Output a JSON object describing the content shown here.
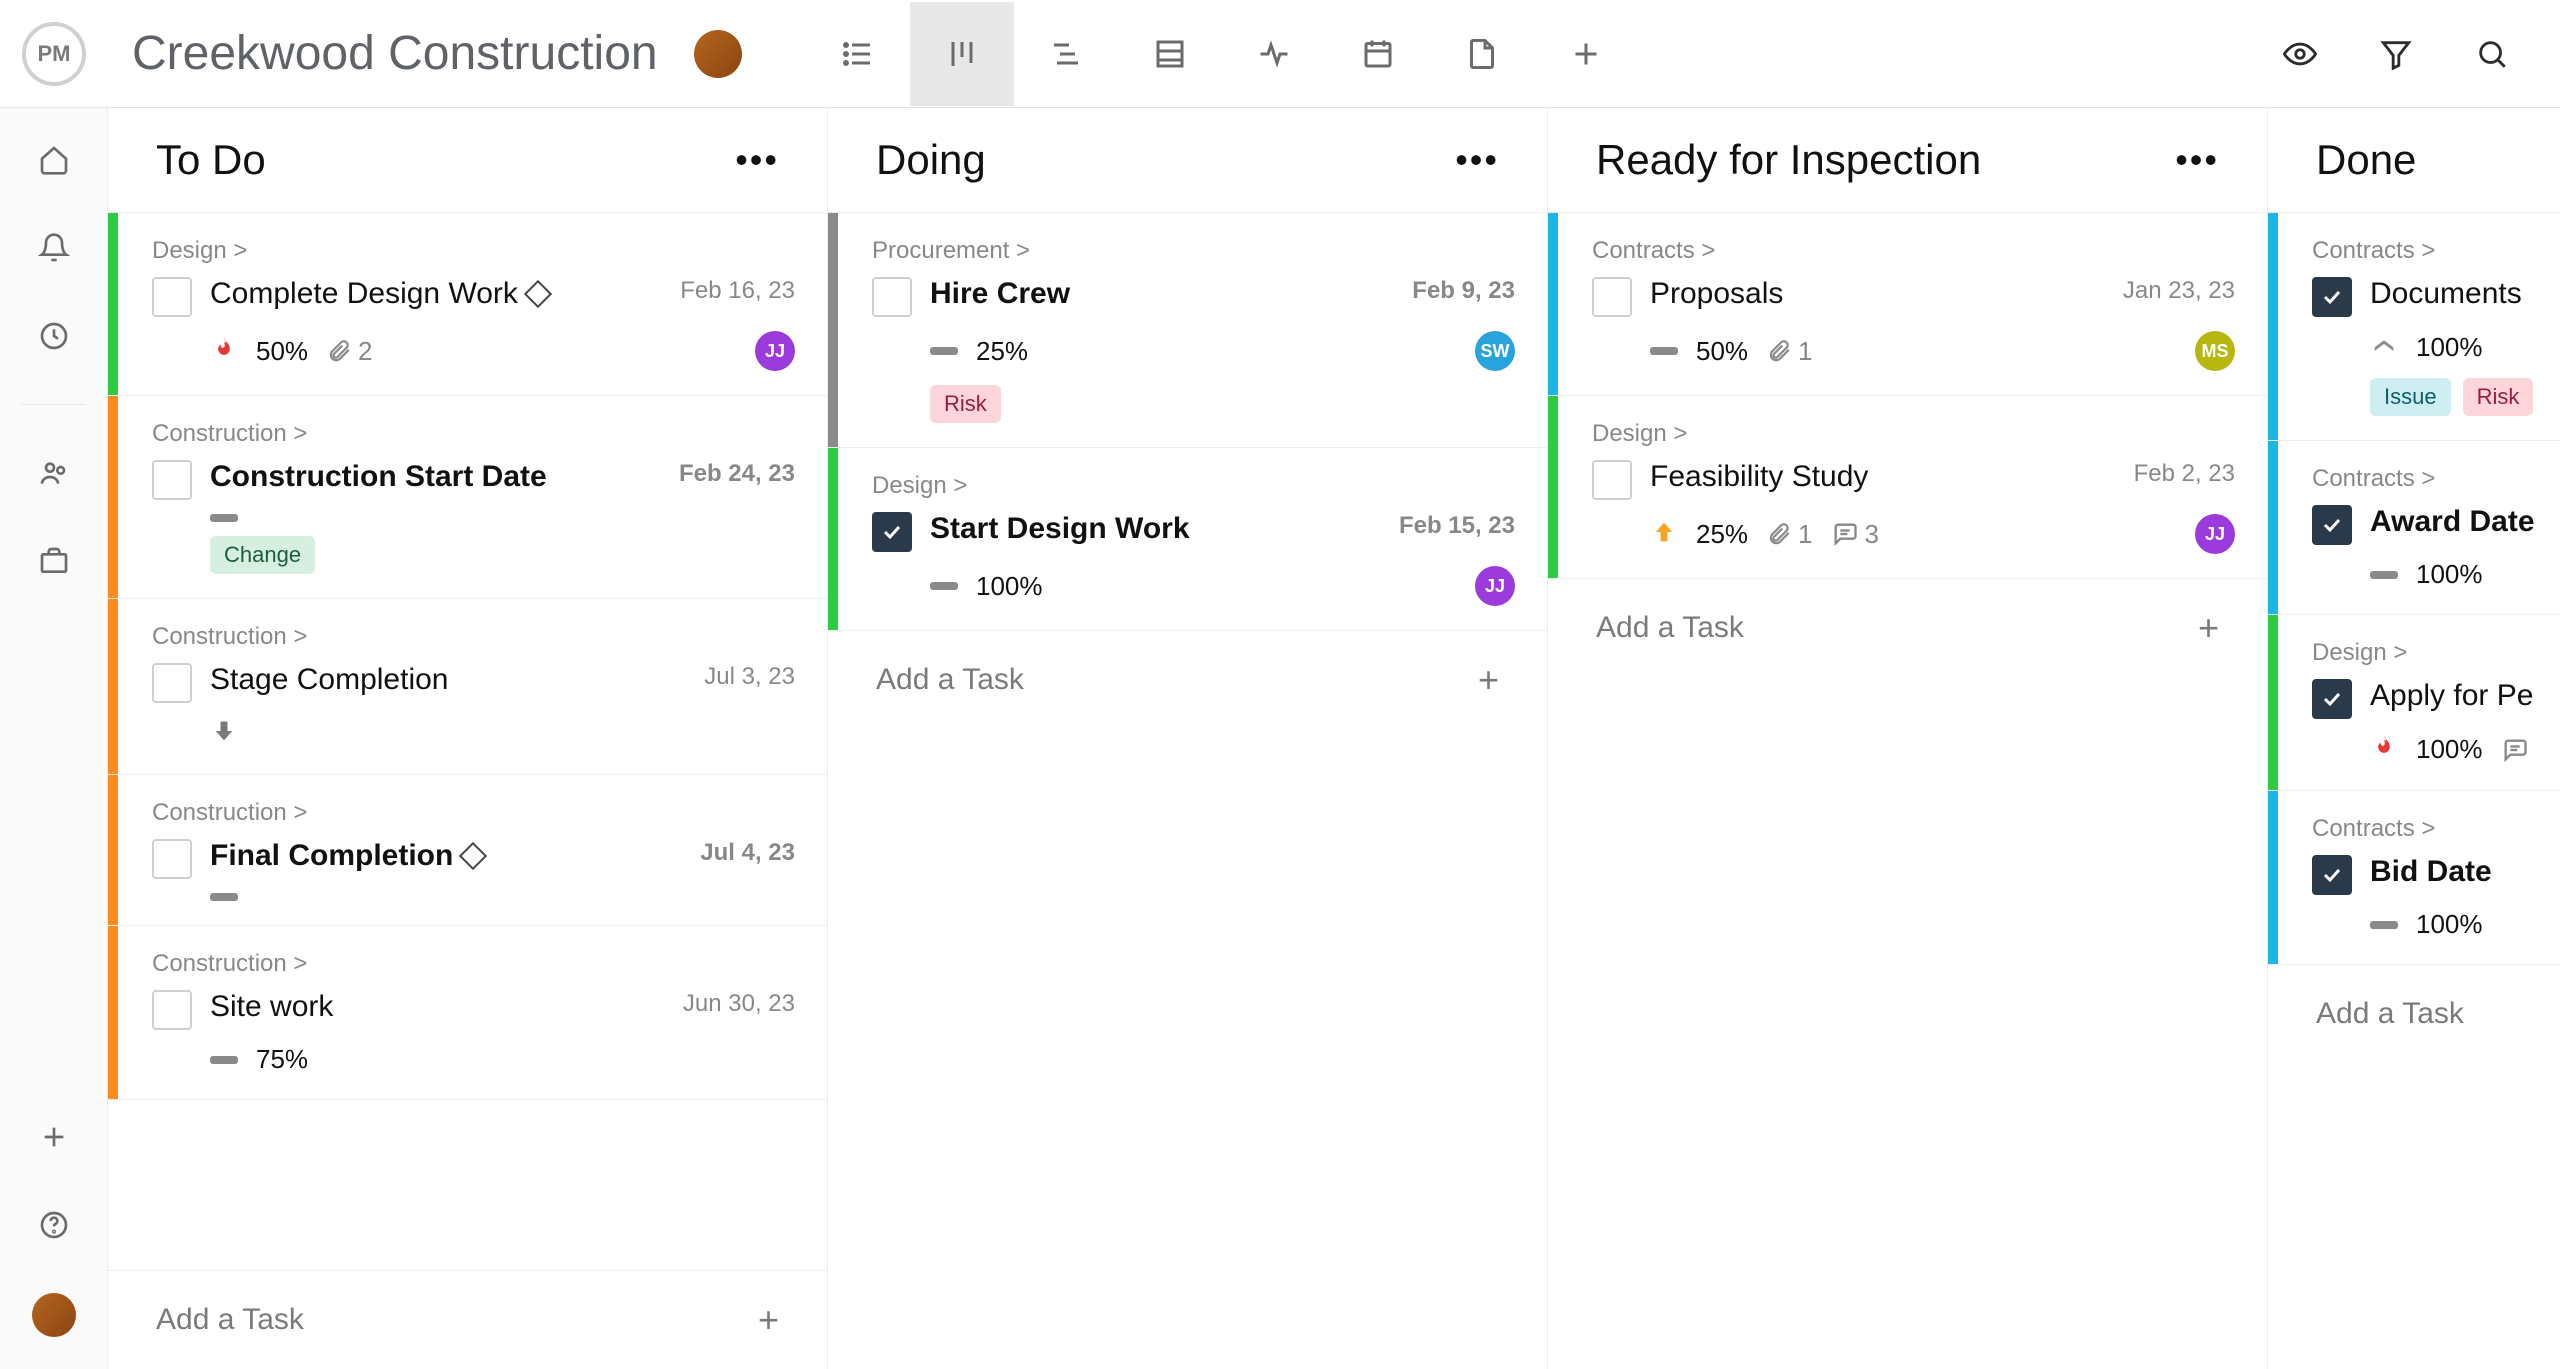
{
  "header": {
    "logo_text": "PM",
    "project_title": "Creekwood Construction"
  },
  "view_buttons": [
    "list",
    "board",
    "gantt",
    "table",
    "activity",
    "calendar",
    "file",
    "add"
  ],
  "active_view": "board",
  "columns": [
    {
      "title": "To Do",
      "add_label": "Add a Task",
      "cards": [
        {
          "stripe": "#2ecc40",
          "category": "Design >",
          "title": "Complete Design Work",
          "bold": false,
          "milestone": true,
          "date": "Feb 16, 23",
          "date_bold": false,
          "checked": false,
          "priority": "flame",
          "percent": "50%",
          "attachments": "2",
          "assignee": {
            "text": "JJ",
            "bg": "#9b3bdb"
          }
        },
        {
          "stripe": "#ff8c1a",
          "category": "Construction >",
          "title": "Construction Start Date",
          "bold": true,
          "milestone": false,
          "date": "Feb 24, 23",
          "date_bold": true,
          "checked": false,
          "priority": "dash",
          "tags": [
            {
              "text": "Change",
              "class": "tag-change"
            }
          ]
        },
        {
          "stripe": "#ff8c1a",
          "category": "Construction >",
          "title": "Stage Completion",
          "bold": false,
          "milestone": false,
          "date": "Jul 3, 23",
          "date_bold": false,
          "checked": false,
          "priority": "down"
        },
        {
          "stripe": "#ff8c1a",
          "category": "Construction >",
          "title": "Final Completion",
          "bold": true,
          "milestone": true,
          "date": "Jul 4, 23",
          "date_bold": true,
          "checked": false,
          "priority": "dash"
        },
        {
          "stripe": "#ff8c1a",
          "category": "Construction >",
          "title": "Site work",
          "bold": false,
          "milestone": false,
          "date": "Jun 30, 23",
          "date_bold": false,
          "checked": false,
          "priority": "dash",
          "percent": "75%"
        }
      ]
    },
    {
      "title": "Doing",
      "add_label": "Add a Task",
      "cards": [
        {
          "stripe": "#8a8a8a",
          "category": "Procurement >",
          "title": "Hire Crew",
          "bold": true,
          "date": "Feb 9, 23",
          "date_bold": true,
          "checked": false,
          "priority": "dash",
          "percent": "25%",
          "assignee": {
            "text": "SW",
            "bg": "#2aa3dc"
          },
          "tags": [
            {
              "text": "Risk",
              "class": "tag-risk"
            }
          ]
        },
        {
          "stripe": "#2ecc40",
          "category": "Design >",
          "title": "Start Design Work",
          "bold": true,
          "date": "Feb 15, 23",
          "date_bold": true,
          "checked": true,
          "priority": "dash",
          "percent": "100%",
          "assignee": {
            "text": "JJ",
            "bg": "#9b3bdb"
          }
        }
      ]
    },
    {
      "title": "Ready for Inspection",
      "add_label": "Add a Task",
      "cards": [
        {
          "stripe": "#1ab7e5",
          "category": "Contracts >",
          "title": "Proposals",
          "bold": false,
          "date": "Jan 23, 23",
          "date_bold": false,
          "checked": false,
          "priority": "dash",
          "percent": "50%",
          "attachments": "1",
          "assignee": {
            "text": "MS",
            "bg": "#b6b80f"
          }
        },
        {
          "stripe": "#2ecc40",
          "category": "Design >",
          "title": "Feasibility Study",
          "bold": false,
          "date": "Feb 2, 23",
          "date_bold": false,
          "checked": false,
          "priority": "up",
          "percent": "25%",
          "attachments": "1",
          "comments": "3",
          "assignee": {
            "text": "JJ",
            "bg": "#9b3bdb"
          }
        }
      ]
    },
    {
      "title": "Done",
      "add_label": "Add a Task",
      "cards": [
        {
          "stripe": "#1ab7e5",
          "category": "Contracts >",
          "title": "Documents",
          "bold": false,
          "checked": true,
          "priority": "level",
          "percent": "100%",
          "tags": [
            {
              "text": "Issue",
              "class": "tag-issue"
            },
            {
              "text": "Risk",
              "class": "tag-risk"
            }
          ]
        },
        {
          "stripe": "#1ab7e5",
          "category": "Contracts >",
          "title": "Award Date",
          "bold": true,
          "checked": true,
          "priority": "dash",
          "percent": "100%"
        },
        {
          "stripe": "#2ecc40",
          "category": "Design >",
          "title": "Apply for Pe",
          "bold": false,
          "checked": true,
          "priority": "flame",
          "percent": "100%",
          "comments": ""
        },
        {
          "stripe": "#1ab7e5",
          "category": "Contracts >",
          "title": "Bid Date",
          "bold": true,
          "checked": true,
          "priority": "dash",
          "percent": "100%"
        }
      ]
    }
  ]
}
